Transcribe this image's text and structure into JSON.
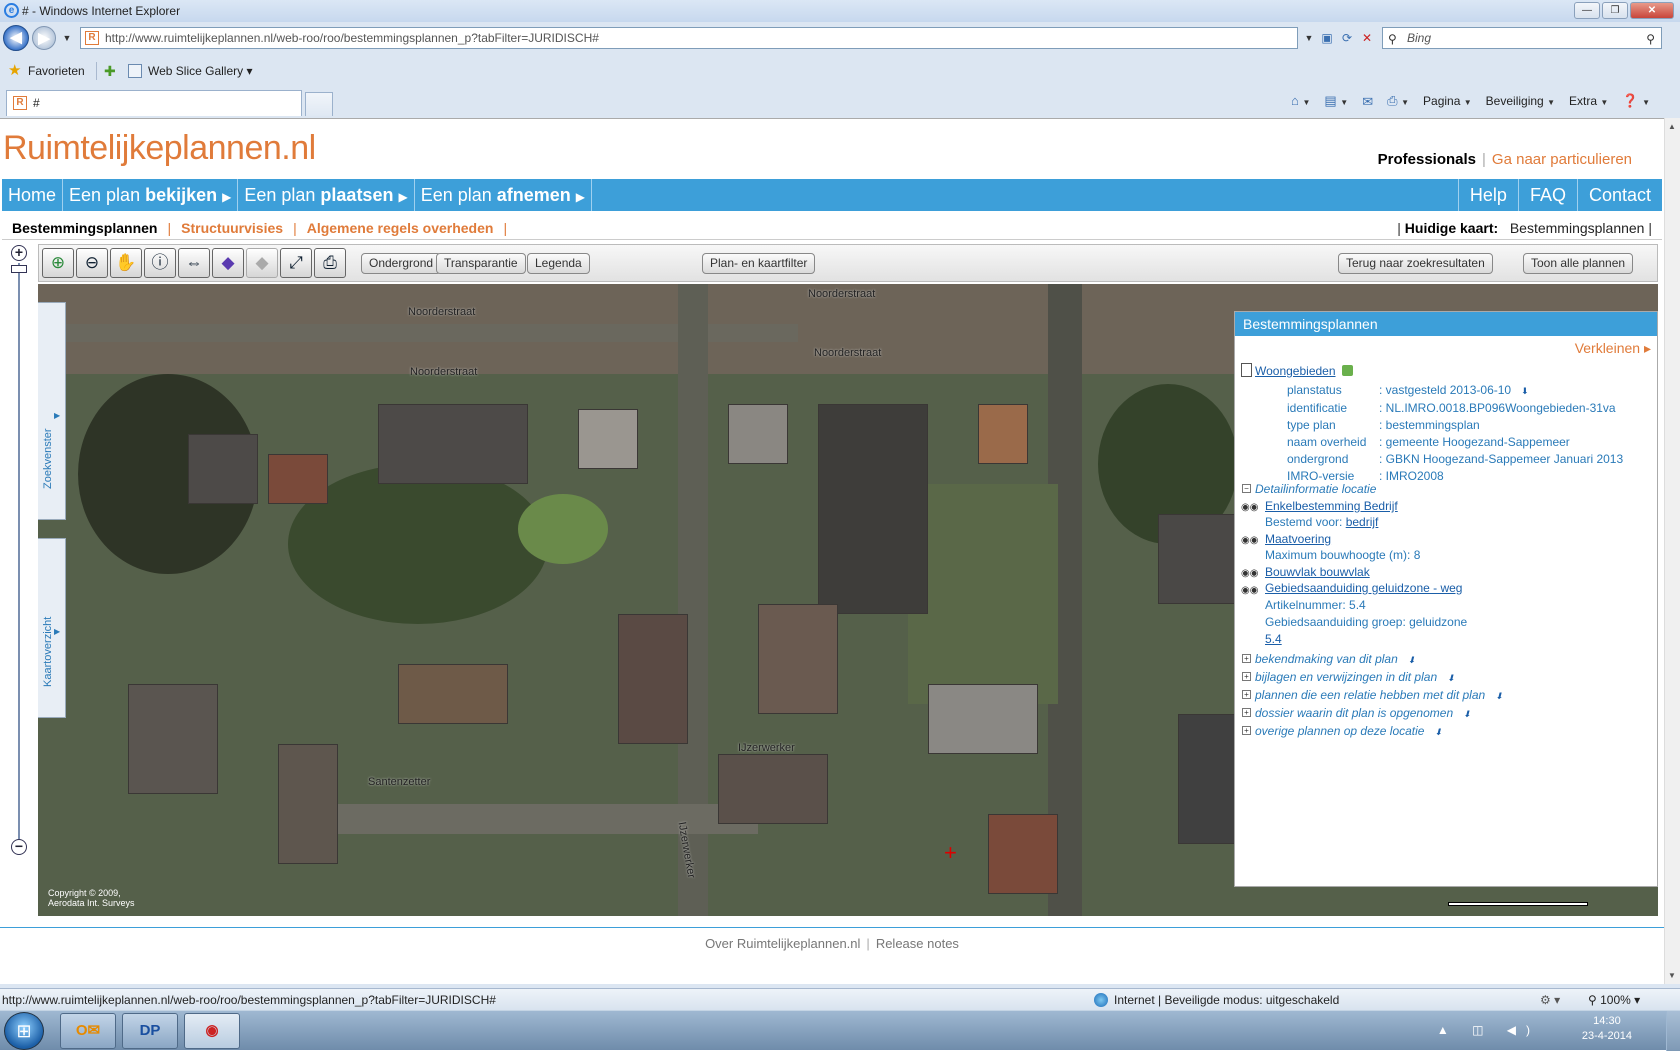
{
  "window": {
    "title": "# - Windows Internet Explorer"
  },
  "browser": {
    "address": "http://www.ruimtelijkeplannen.nl/web-roo/roo/bestemmingsplannen_p?tabFilter=JURIDISCH#",
    "address_host": "www.ruimtelijkeplannen.nl",
    "search_placeholder": "Bing",
    "favorites_label": "Favorieten",
    "webslice_label": "Web Slice Gallery",
    "tab_title": "#",
    "cmd": {
      "pagina": "Pagina",
      "beveiliging": "Beveiliging",
      "extra": "Extra"
    }
  },
  "site": {
    "logo": "Ruimtelijkeplannen.nl",
    "professionals": "Professionals",
    "particulieren": "Ga naar particulieren",
    "nav": [
      {
        "pre": "Home",
        "bold": "",
        "arrow": ""
      },
      {
        "pre": "Een plan ",
        "bold": "bekijken",
        "arrow": "▶"
      },
      {
        "pre": "Een plan ",
        "bold": "plaatsen",
        "arrow": "▶"
      },
      {
        "pre": "Een plan ",
        "bold": "afnemen",
        "arrow": "▶"
      }
    ],
    "nav_right": [
      "Help",
      "FAQ",
      "Contact"
    ],
    "subnav": {
      "current": "Bestemmingsplannen",
      "links": [
        "Structuurvisies",
        "Algemene regels overheden"
      ],
      "map_label": "Huidige kaart:",
      "map_value": "Bestemmingsplannen"
    }
  },
  "map": {
    "buttons": {
      "ondergrond": "Ondergrond",
      "transparantie": "Transparantie",
      "legenda": "Legenda",
      "filter": "Plan- en kaartfilter",
      "terug": "Terug naar zoekresultaten",
      "toon": "Toon alle plannen"
    },
    "side_tabs": [
      "Zoekvenster",
      "Kaartoverzicht"
    ],
    "street_labels": [
      "Noorderstraat",
      "Noorderstraat",
      "Noorderstraat",
      "Noorderstraat",
      "Santenzetter",
      "IJzerwerker",
      "IJzerwerker"
    ],
    "copyright_1": "Copyright © 2009,",
    "copyright_2": "Aerodata Int. Surveys"
  },
  "panel": {
    "title": "Bestemmingsplannen",
    "shrink": "Verkleinen",
    "plan_name": "Woongebieden",
    "properties": [
      {
        "key": "planstatus",
        "value": ": vastgesteld 2013-06-10"
      },
      {
        "key": "identificatie",
        "value": ": NL.IMRO.0018.BP096Woongebieden-31va"
      },
      {
        "key": "type plan",
        "value": ": bestemmingsplan"
      },
      {
        "key": "naam overheid",
        "value": ": gemeente Hoogezand-Sappemeer"
      },
      {
        "key": "ondergrond",
        "value": ": GBKN Hoogezand-Sappemeer Januari 2013"
      },
      {
        "key": "IMRO-versie",
        "value": ": IMRO2008"
      }
    ],
    "detail_header": "Detailinformatie locatie",
    "details": {
      "d1_link": "Enkelbestemming Bedrijf",
      "d1_sub_label": "Bestemd voor: ",
      "d1_sub_link": "bedrijf",
      "d2_link": "Maatvoering",
      "d2_sub": "Maximum bouwhoogte (m): 8",
      "d3_link": "Bouwvlak bouwvlak",
      "d4_link": "Gebiedsaanduiding geluidzone - weg",
      "d4_sub1": "Artikelnummer: 5.4",
      "d4_sub2": "Gebiedsaanduiding groep: geluidzone",
      "d4_sub3": "5.4"
    },
    "sections": [
      "bekendmaking van dit plan",
      "bijlagen en verwijzingen in dit plan",
      "plannen die een relatie hebben met dit plan",
      "dossier waarin dit plan is opgenomen",
      "overige plannen op deze locatie"
    ]
  },
  "footer": {
    "about": "Over Ruimtelijkeplannen.nl",
    "release": "Release notes"
  },
  "status": {
    "url": "http://www.ruimtelijkeplannen.nl/web-roo/roo/bestemmingsplannen_p?tabFilter=JURIDISCH#",
    "zone": "Internet | Beveiligde modus: uitgeschakeld",
    "zoom": "100%"
  },
  "taskbar": {
    "time": "14:30",
    "date": "23-4-2014",
    "app2": "DP"
  }
}
